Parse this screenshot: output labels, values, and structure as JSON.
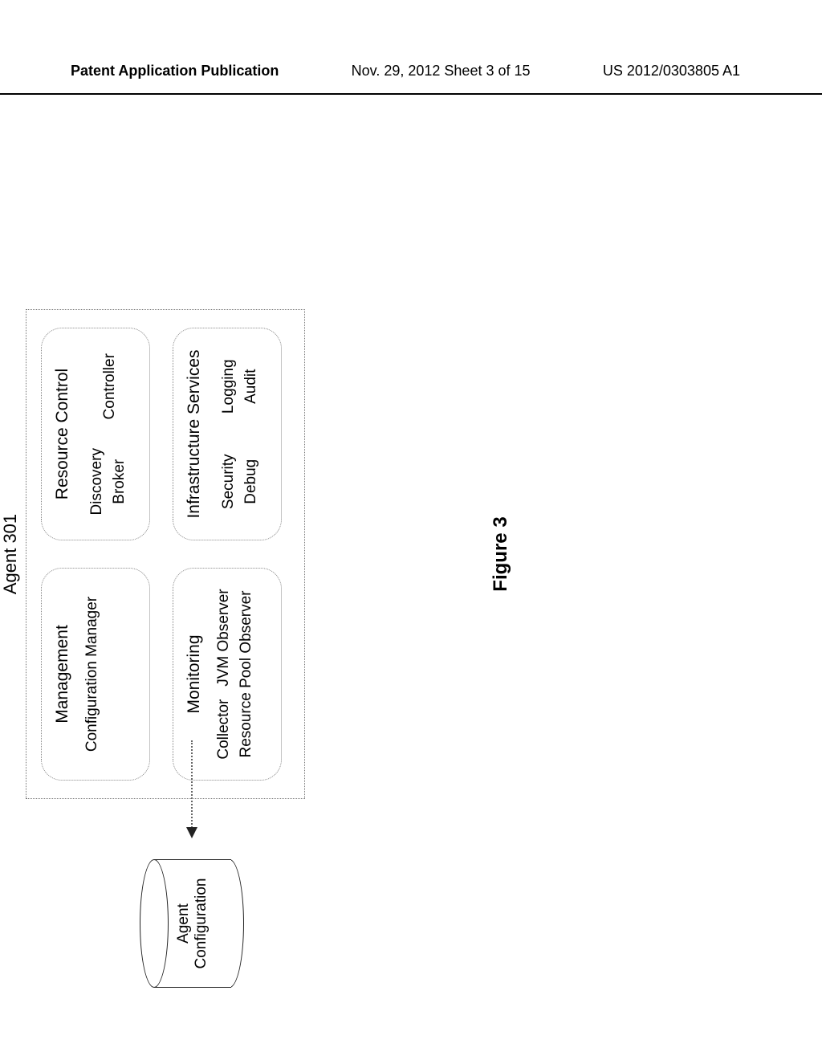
{
  "header": {
    "left": "Patent Application Publication",
    "mid": "Nov. 29, 2012  Sheet 3 of 15",
    "right": "US 2012/0303805 A1"
  },
  "diagram": {
    "agent_label": "Agent 301",
    "management": {
      "title": "Management",
      "item": "Configuration Manager"
    },
    "resource": {
      "title": "Resource Control",
      "left": {
        "a": "Discovery",
        "b": "Broker"
      },
      "right": {
        "a": "Controller"
      }
    },
    "monitoring": {
      "title": "Monitoring",
      "row1_left": "Collector",
      "row1_right": "JVM Observer",
      "row2": "Resource Pool Observer"
    },
    "infra": {
      "title": "Infrastructure Services",
      "left": {
        "a": "Security",
        "b": "Debug"
      },
      "right": {
        "a": "Logging",
        "b": "Audit"
      }
    },
    "cylinder": {
      "l1": "Agent",
      "l2": "Configuration"
    },
    "caption": "Figure 3"
  }
}
